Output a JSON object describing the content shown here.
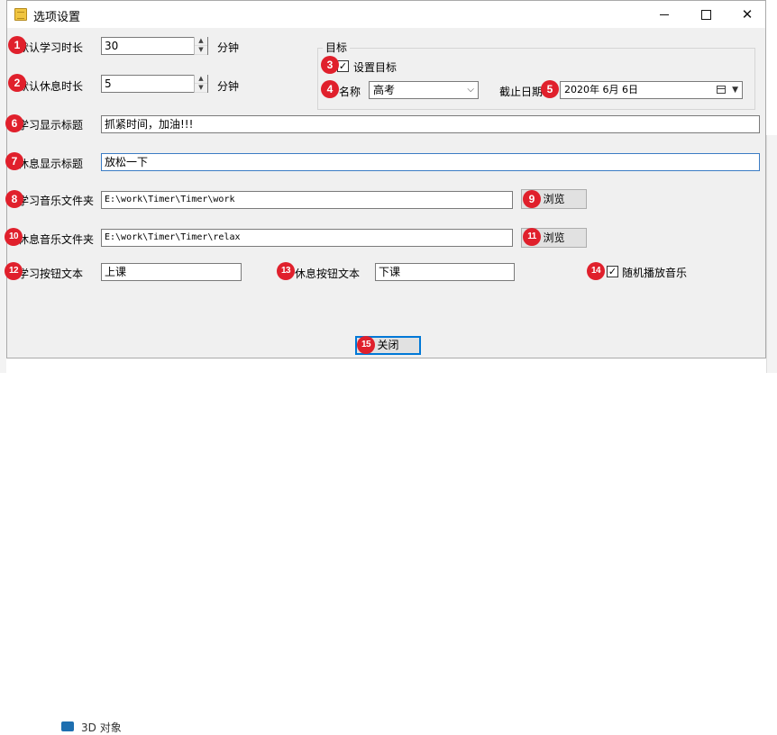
{
  "window": {
    "title": "选项设置",
    "controls": {
      "minimize": "",
      "maximize": "",
      "close": "✕"
    }
  },
  "fields": {
    "study_duration": {
      "label": "默认学习时长",
      "value": "30",
      "unit": "分钟"
    },
    "rest_duration": {
      "label": "默认休息时长",
      "value": "5",
      "unit": "分钟"
    },
    "study_title": {
      "label": "学习显示标题",
      "value": "抓紧时间，加油!!!"
    },
    "rest_title": {
      "label": "休息显示标题",
      "value": "放松一下"
    },
    "study_music": {
      "label": "学习音乐文件夹",
      "value": "E:\\work\\Timer\\Timer\\work",
      "browse": "浏览"
    },
    "rest_music": {
      "label": "休息音乐文件夹",
      "value": "E:\\work\\Timer\\Timer\\relax",
      "browse": "浏览"
    },
    "study_button": {
      "label": "学习按钮文本",
      "value": "上课"
    },
    "rest_button": {
      "label": "休息按钮文本",
      "value": "下课"
    },
    "random_music": {
      "label": "随机播放音乐",
      "checked": true
    }
  },
  "goal": {
    "group_title": "目标",
    "set_goal": {
      "label": "设置目标",
      "checked": true
    },
    "name": {
      "label": "名称",
      "value": "高考"
    },
    "deadline": {
      "label": "截止日期",
      "value": "2020年  6月  6日"
    }
  },
  "close_button": "关闭",
  "badges": [
    "1",
    "2",
    "3",
    "4",
    "5",
    "6",
    "7",
    "8",
    "9",
    "10",
    "11",
    "12",
    "13",
    "14",
    "15"
  ],
  "background": {
    "item": "3D 对象"
  },
  "colors": {
    "badge": "#e0202c",
    "focus": "#0078d7",
    "window_bg": "#f0f0f0"
  }
}
